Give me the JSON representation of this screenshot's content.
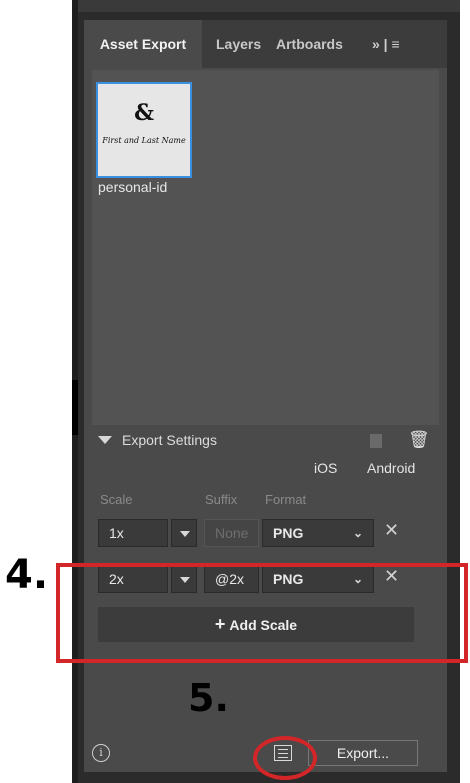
{
  "tabs": [
    {
      "label": "Asset Export",
      "active": true
    },
    {
      "label": "Layers",
      "active": false
    },
    {
      "label": "Artboards",
      "active": false
    }
  ],
  "overflow_label": "» | ≡",
  "asset": {
    "thumbnail_symbol": "&",
    "thumbnail_text": "First and Last Name",
    "name": "personal-id"
  },
  "export_settings": {
    "label": "Export Settings",
    "platforms": [
      "iOS",
      "Android"
    ],
    "columns": {
      "scale": "Scale",
      "suffix": "Suffix",
      "format": "Format"
    },
    "rows": [
      {
        "scale": "1x",
        "suffix": "",
        "suffix_placeholder": "None",
        "format": "PNG"
      },
      {
        "scale": "2x",
        "suffix": "@2x",
        "suffix_placeholder": "None",
        "format": "PNG"
      }
    ],
    "add_scale_label": "Add Scale"
  },
  "footer": {
    "info_glyph": "i",
    "export_label": "Export..."
  },
  "annotations": {
    "step4": "4.",
    "step5": "5.",
    "highlight_color": "#d22628"
  },
  "colors": {
    "panel_bg": "#4a4a4a",
    "tab_bar_bg": "#3c3c3c",
    "selection_blue": "#3b8fe0"
  }
}
